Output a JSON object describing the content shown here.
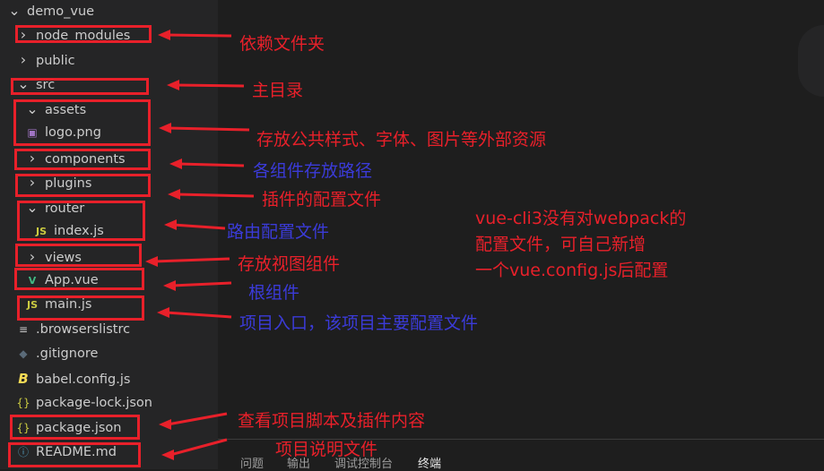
{
  "explorer": {
    "items": [
      {
        "label": "demo_vue",
        "icon": "chevron-down"
      },
      {
        "label": "node_modules",
        "icon": "chevron-right"
      },
      {
        "label": "public",
        "icon": "chevron-right"
      },
      {
        "label": "src",
        "icon": "chevron-down"
      },
      {
        "label": "assets",
        "icon": "chevron-down"
      },
      {
        "label": "logo.png",
        "icon": "image"
      },
      {
        "label": "components",
        "icon": "chevron-right"
      },
      {
        "label": "plugins",
        "icon": "chevron-right"
      },
      {
        "label": "router",
        "icon": "chevron-down"
      },
      {
        "label": "index.js",
        "icon": "js"
      },
      {
        "label": "views",
        "icon": "chevron-right"
      },
      {
        "label": "App.vue",
        "icon": "vue"
      },
      {
        "label": "main.js",
        "icon": "js"
      },
      {
        "label": ".browserslistrc",
        "icon": "lines"
      },
      {
        "label": ".gitignore",
        "icon": "git"
      },
      {
        "label": "babel.config.js",
        "icon": "babel"
      },
      {
        "label": "package-lock.json",
        "icon": "json"
      },
      {
        "label": "package.json",
        "icon": "json"
      },
      {
        "label": "README.md",
        "icon": "info"
      }
    ]
  },
  "panel": {
    "tabs": [
      "问题",
      "输出",
      "调试控制台",
      "终端"
    ],
    "active": "终端"
  },
  "annotations": {
    "node_modules": "依赖文件夹",
    "src": "主目录",
    "assets": "存放公共样式、字体、图片等外部资源",
    "components": "各组件存放路径",
    "plugins": "插件的配置文件",
    "router": "路由配置文件",
    "views": "存放视图组件",
    "app": "根组件",
    "main": "项目入口，该项目主要配置文件",
    "package": "查看项目脚本及插件内容",
    "readme": "项目说明文件",
    "vue_cli_line1": "vue-cli3没有对webpack的",
    "vue_cli_line2": "配置文件，可自己新增",
    "vue_cli_line3": "一个vue.config.js后配置"
  },
  "colors": {
    "annotation_red": "#e8202a",
    "annotation_blue": "#3b3bd9"
  }
}
